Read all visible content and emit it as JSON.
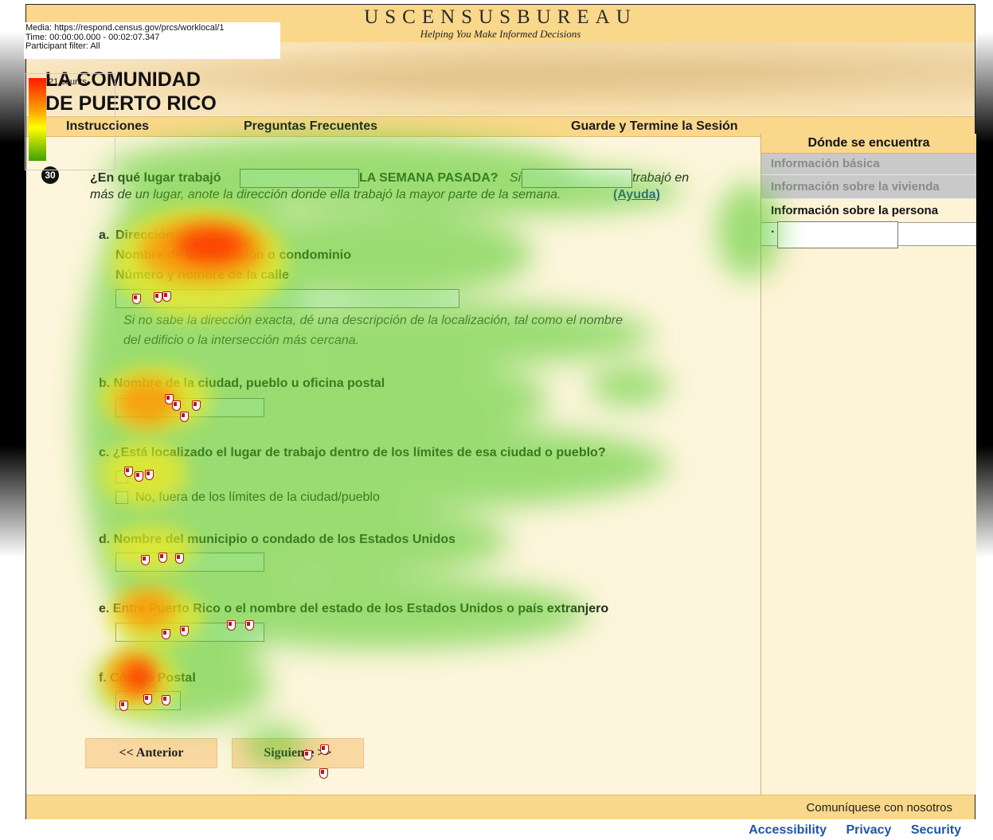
{
  "overlay": {
    "media": "Media: https://respond.census.gov/prcs/worklocal/1",
    "time": "Time: 00:00:00.000 - 00:02:07.347",
    "participant": "Participant filter: All",
    "legend_label": "21 counts"
  },
  "header": {
    "title": "USCENSUSBUREAU",
    "tagline": "Helping You Make Informed Decisions",
    "banner_line1": "LA COMUNIDAD",
    "banner_line2": "DE PUERTO RICO"
  },
  "nav": {
    "instructions": "Instrucciones",
    "faq": "Preguntas Frecuentes",
    "save_exit": "Guarde y Termine la Sesión"
  },
  "sidebar": {
    "heading": "Dónde se encuentra",
    "items": [
      {
        "label": "Información básica"
      },
      {
        "label": "Información sobre la vivienda"
      },
      {
        "label": "Información sobre la persona"
      }
    ],
    "person_dot": "·"
  },
  "question": {
    "number": "30",
    "text_start": "¿En qué lugar trabajó",
    "text_mid": "LA SEMANA PASADA?",
    "text_si": "Si",
    "text_end": "trabajó en",
    "line2": "más de un lugar, anote la dirección donde ella trabajó la mayor parte de la semana.",
    "help_link": "(Ayuda)"
  },
  "parts": {
    "a_letter": "a.",
    "a_title": "Dirección",
    "a_sub1": "Nombre de urbanización o condominio",
    "a_sub2": "Número y nombre de la calle",
    "a_help1": "Si no sabe la dirección exacta, dé una descripción de la localización, tal como el nombre",
    "a_help2": "del edificio o la intersección más cercana.",
    "b": "b. Nombre de la ciudad, pueblo u oficina postal",
    "c": "c. ¿Está localizado el lugar de trabajo dentro de los límites de esa ciudad o pueblo?",
    "c_option": "No, fuera de los límites de la ciudad/pueblo",
    "d": "d. Nombre del municipio o condado de los Estados Unidos",
    "e": "e. Entre Puerto Rico o el nombre del estado de los Estados Unidos o país extranjero",
    "f": "f. Código Postal"
  },
  "buttons": {
    "previous": "<<  Anterior",
    "next": "Siguiente >>"
  },
  "footer": {
    "contact": "Comuníquese con nosotros",
    "accessibility": "Accessibility",
    "privacy": "Privacy",
    "security": "Security"
  },
  "colors": {
    "bar": "#fad88b",
    "page_bg": "#fdf6dc",
    "heat_hot": "#ff2a00",
    "heat_cool": "#4cc81a",
    "link": "#1f56a6"
  }
}
